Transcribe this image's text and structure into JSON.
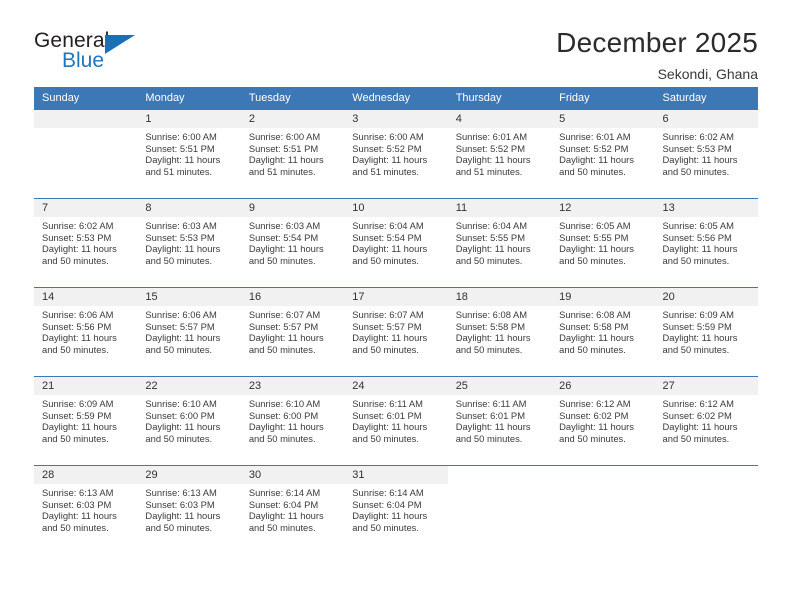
{
  "logo": {
    "word_one": "General",
    "word_two": "Blue",
    "triangle_icon": "triangle-icon",
    "accent_color": "#1a6fb5"
  },
  "header": {
    "title": "December 2025",
    "subtitle": "Sekondi, Ghana"
  },
  "theme": {
    "header_blue": "#3c78b5",
    "date_band_gray": "#f1f1f1",
    "text_color": "#3b3b3b"
  },
  "calendar": {
    "weekday_headers": [
      "Sunday",
      "Monday",
      "Tuesday",
      "Wednesday",
      "Thursday",
      "Friday",
      "Saturday"
    ],
    "weeks": [
      [
        {
          "day": "",
          "lines": []
        },
        {
          "day": "1",
          "lines": [
            "Sunrise: 6:00 AM",
            "Sunset: 5:51 PM",
            "Daylight: 11 hours",
            "and 51 minutes."
          ]
        },
        {
          "day": "2",
          "lines": [
            "Sunrise: 6:00 AM",
            "Sunset: 5:51 PM",
            "Daylight: 11 hours",
            "and 51 minutes."
          ]
        },
        {
          "day": "3",
          "lines": [
            "Sunrise: 6:00 AM",
            "Sunset: 5:52 PM",
            "Daylight: 11 hours",
            "and 51 minutes."
          ]
        },
        {
          "day": "4",
          "lines": [
            "Sunrise: 6:01 AM",
            "Sunset: 5:52 PM",
            "Daylight: 11 hours",
            "and 51 minutes."
          ]
        },
        {
          "day": "5",
          "lines": [
            "Sunrise: 6:01 AM",
            "Sunset: 5:52 PM",
            "Daylight: 11 hours",
            "and 50 minutes."
          ]
        },
        {
          "day": "6",
          "lines": [
            "Sunrise: 6:02 AM",
            "Sunset: 5:53 PM",
            "Daylight: 11 hours",
            "and 50 minutes."
          ]
        }
      ],
      [
        {
          "day": "7",
          "lines": [
            "Sunrise: 6:02 AM",
            "Sunset: 5:53 PM",
            "Daylight: 11 hours",
            "and 50 minutes."
          ]
        },
        {
          "day": "8",
          "lines": [
            "Sunrise: 6:03 AM",
            "Sunset: 5:53 PM",
            "Daylight: 11 hours",
            "and 50 minutes."
          ]
        },
        {
          "day": "9",
          "lines": [
            "Sunrise: 6:03 AM",
            "Sunset: 5:54 PM",
            "Daylight: 11 hours",
            "and 50 minutes."
          ]
        },
        {
          "day": "10",
          "lines": [
            "Sunrise: 6:04 AM",
            "Sunset: 5:54 PM",
            "Daylight: 11 hours",
            "and 50 minutes."
          ]
        },
        {
          "day": "11",
          "lines": [
            "Sunrise: 6:04 AM",
            "Sunset: 5:55 PM",
            "Daylight: 11 hours",
            "and 50 minutes."
          ]
        },
        {
          "day": "12",
          "lines": [
            "Sunrise: 6:05 AM",
            "Sunset: 5:55 PM",
            "Daylight: 11 hours",
            "and 50 minutes."
          ]
        },
        {
          "day": "13",
          "lines": [
            "Sunrise: 6:05 AM",
            "Sunset: 5:56 PM",
            "Daylight: 11 hours",
            "and 50 minutes."
          ]
        }
      ],
      [
        {
          "day": "14",
          "lines": [
            "Sunrise: 6:06 AM",
            "Sunset: 5:56 PM",
            "Daylight: 11 hours",
            "and 50 minutes."
          ]
        },
        {
          "day": "15",
          "lines": [
            "Sunrise: 6:06 AM",
            "Sunset: 5:57 PM",
            "Daylight: 11 hours",
            "and 50 minutes."
          ]
        },
        {
          "day": "16",
          "lines": [
            "Sunrise: 6:07 AM",
            "Sunset: 5:57 PM",
            "Daylight: 11 hours",
            "and 50 minutes."
          ]
        },
        {
          "day": "17",
          "lines": [
            "Sunrise: 6:07 AM",
            "Sunset: 5:57 PM",
            "Daylight: 11 hours",
            "and 50 minutes."
          ]
        },
        {
          "day": "18",
          "lines": [
            "Sunrise: 6:08 AM",
            "Sunset: 5:58 PM",
            "Daylight: 11 hours",
            "and 50 minutes."
          ]
        },
        {
          "day": "19",
          "lines": [
            "Sunrise: 6:08 AM",
            "Sunset: 5:58 PM",
            "Daylight: 11 hours",
            "and 50 minutes."
          ]
        },
        {
          "day": "20",
          "lines": [
            "Sunrise: 6:09 AM",
            "Sunset: 5:59 PM",
            "Daylight: 11 hours",
            "and 50 minutes."
          ]
        }
      ],
      [
        {
          "day": "21",
          "lines": [
            "Sunrise: 6:09 AM",
            "Sunset: 5:59 PM",
            "Daylight: 11 hours",
            "and 50 minutes."
          ]
        },
        {
          "day": "22",
          "lines": [
            "Sunrise: 6:10 AM",
            "Sunset: 6:00 PM",
            "Daylight: 11 hours",
            "and 50 minutes."
          ]
        },
        {
          "day": "23",
          "lines": [
            "Sunrise: 6:10 AM",
            "Sunset: 6:00 PM",
            "Daylight: 11 hours",
            "and 50 minutes."
          ]
        },
        {
          "day": "24",
          "lines": [
            "Sunrise: 6:11 AM",
            "Sunset: 6:01 PM",
            "Daylight: 11 hours",
            "and 50 minutes."
          ]
        },
        {
          "day": "25",
          "lines": [
            "Sunrise: 6:11 AM",
            "Sunset: 6:01 PM",
            "Daylight: 11 hours",
            "and 50 minutes."
          ]
        },
        {
          "day": "26",
          "lines": [
            "Sunrise: 6:12 AM",
            "Sunset: 6:02 PM",
            "Daylight: 11 hours",
            "and 50 minutes."
          ]
        },
        {
          "day": "27",
          "lines": [
            "Sunrise: 6:12 AM",
            "Sunset: 6:02 PM",
            "Daylight: 11 hours",
            "and 50 minutes."
          ]
        }
      ],
      [
        {
          "day": "28",
          "lines": [
            "Sunrise: 6:13 AM",
            "Sunset: 6:03 PM",
            "Daylight: 11 hours",
            "and 50 minutes."
          ]
        },
        {
          "day": "29",
          "lines": [
            "Sunrise: 6:13 AM",
            "Sunset: 6:03 PM",
            "Daylight: 11 hours",
            "and 50 minutes."
          ]
        },
        {
          "day": "30",
          "lines": [
            "Sunrise: 6:14 AM",
            "Sunset: 6:04 PM",
            "Daylight: 11 hours",
            "and 50 minutes."
          ]
        },
        {
          "day": "31",
          "lines": [
            "Sunrise: 6:14 AM",
            "Sunset: 6:04 PM",
            "Daylight: 11 hours",
            "and 50 minutes."
          ]
        },
        {
          "day": "",
          "lines": []
        },
        {
          "day": "",
          "lines": []
        },
        {
          "day": "",
          "lines": []
        }
      ]
    ]
  }
}
